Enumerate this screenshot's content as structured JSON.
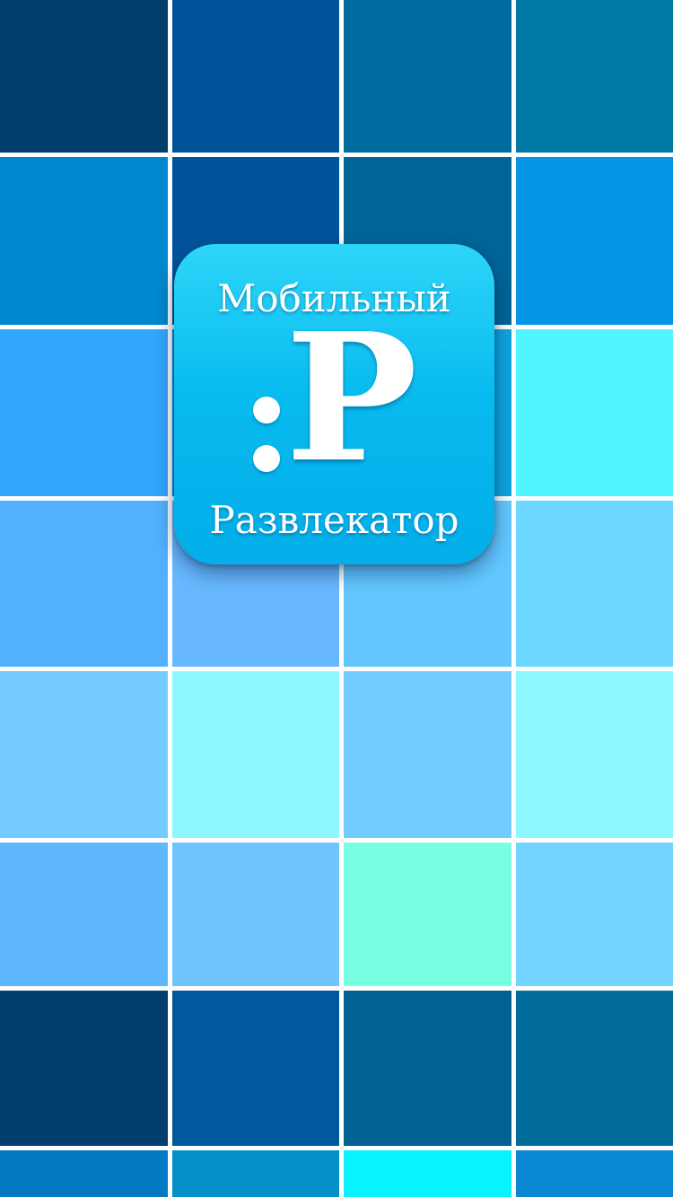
{
  "screen": {
    "background_color": "#ffffff",
    "tile_grid": {
      "columns": 4,
      "rows": [
        [
          "#023f6d",
          "#00559a",
          "#006b9f",
          "#0079a5"
        ],
        [
          "#0088cf",
          "#00549b",
          "#006597",
          "#0597e5"
        ],
        [
          "#32a6fd",
          "#0c88d6",
          "#0fa4dd",
          "#50f5ff"
        ],
        [
          "#52b1fe",
          "#68b8ff",
          "#63c7ff",
          "#6cd8ff"
        ],
        [
          "#75caff",
          "#8ef7ff",
          "#73ccff",
          "#8df8ff"
        ],
        [
          "#5fb7fd",
          "#70c4fe",
          "#77ffe3",
          "#73d4ff"
        ],
        [
          "#023e6e",
          "#00589d",
          "#036093",
          "#026d9b"
        ],
        [
          "#0279c2",
          "#0390c7",
          "#09f2ff",
          "#0b88d4"
        ]
      ]
    }
  },
  "logo": {
    "icon": "app-logo-icon",
    "top_text": "Мобильный",
    "mark_letter": "P",
    "bottom_text": "Развлекатор",
    "colors": {
      "top": "#16d0f7",
      "bottom": "#04aee9",
      "text": "#ffffff"
    }
  }
}
